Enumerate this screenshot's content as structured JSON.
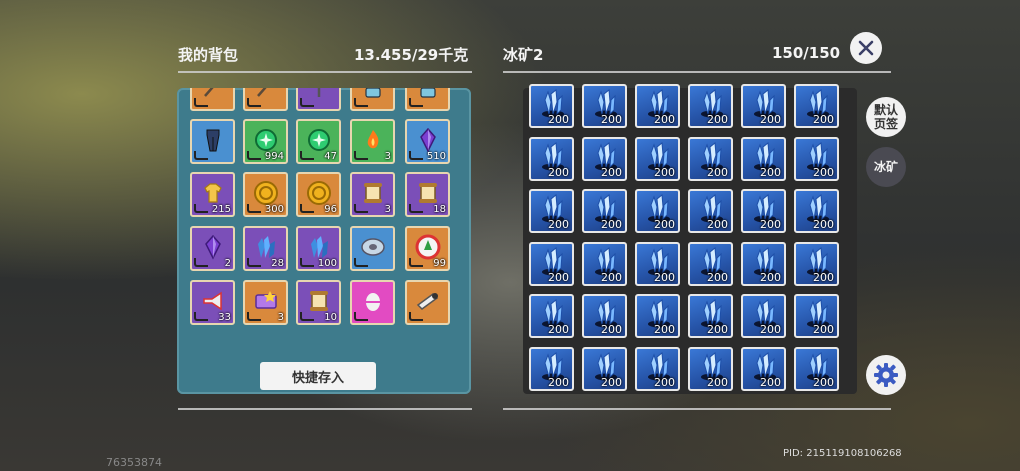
{
  "left_panel": {
    "title": "我的背包",
    "capacity": "13.455/29千克",
    "quick_store_label": "快捷存入",
    "rows": [
      [
        {
          "name": "scythe-icon",
          "bg": "#d9893c",
          "count": ""
        },
        {
          "name": "pickaxe-icon",
          "bg": "#d9893c",
          "count": ""
        },
        {
          "name": "crossbow-icon",
          "bg": "#7b4fb8",
          "count": ""
        },
        {
          "name": "mech-icon",
          "bg": "#d9893c",
          "count": ""
        },
        {
          "name": "armor-icon",
          "bg": "#d9893c",
          "count": ""
        }
      ],
      [
        {
          "name": "leggings-icon",
          "bg": "#4a90d0",
          "count": ""
        },
        {
          "name": "green-orb-icon",
          "bg": "#4bb35a",
          "count": "994"
        },
        {
          "name": "green-orb-icon",
          "bg": "#4bb35a",
          "count": "47"
        },
        {
          "name": "flame-icon",
          "bg": "#4bb35a",
          "count": "3"
        },
        {
          "name": "purple-crystal-icon",
          "bg": "#4a90d0",
          "count": "510"
        }
      ],
      [
        {
          "name": "gold-shirt-icon",
          "bg": "#7b4fb8",
          "count": "215"
        },
        {
          "name": "gold-coin-icon",
          "bg": "#d9893c",
          "count": "300"
        },
        {
          "name": "gold-coin-skull-icon",
          "bg": "#d9893c",
          "count": "96"
        },
        {
          "name": "scroll-icon",
          "bg": "#7b4fb8",
          "count": "3"
        },
        {
          "name": "scroll-icon",
          "bg": "#7b4fb8",
          "count": "18"
        }
      ],
      [
        {
          "name": "purple-gem-icon",
          "bg": "#7b4fb8",
          "count": "2"
        },
        {
          "name": "blue-crystal-icon",
          "bg": "#7b4fb8",
          "count": "28"
        },
        {
          "name": "blue-crystal-icon",
          "bg": "#7b4fb8",
          "count": "100"
        },
        {
          "name": "disc-icon",
          "bg": "#4a90d0",
          "count": ""
        },
        {
          "name": "badge-icon",
          "bg": "#d9893c",
          "count": "99"
        }
      ],
      [
        {
          "name": "megaphone-icon",
          "bg": "#7b4fb8",
          "count": "33"
        },
        {
          "name": "card-icon",
          "bg": "#d9893c",
          "count": "3"
        },
        {
          "name": "scroll-icon",
          "bg": "#7b4fb8",
          "count": "10"
        },
        {
          "name": "pink-egg-icon",
          "bg": "#e24bc2",
          "count": ""
        },
        {
          "name": "horn-icon",
          "bg": "#d9893c",
          "count": ""
        }
      ]
    ]
  },
  "right_panel": {
    "title": "冰矿2",
    "capacity": "150/150",
    "item_icon": "ice-crystal-icon",
    "rows": 6,
    "cols": 6,
    "count": "200"
  },
  "side_buttons": {
    "default_page": "默认\n页签",
    "ice_ore": "冰矿"
  },
  "close_icon": "close-icon",
  "settings_icon": "gear-icon",
  "pid_text": "PID: 215119108106268",
  "uid_text": "76353874"
}
